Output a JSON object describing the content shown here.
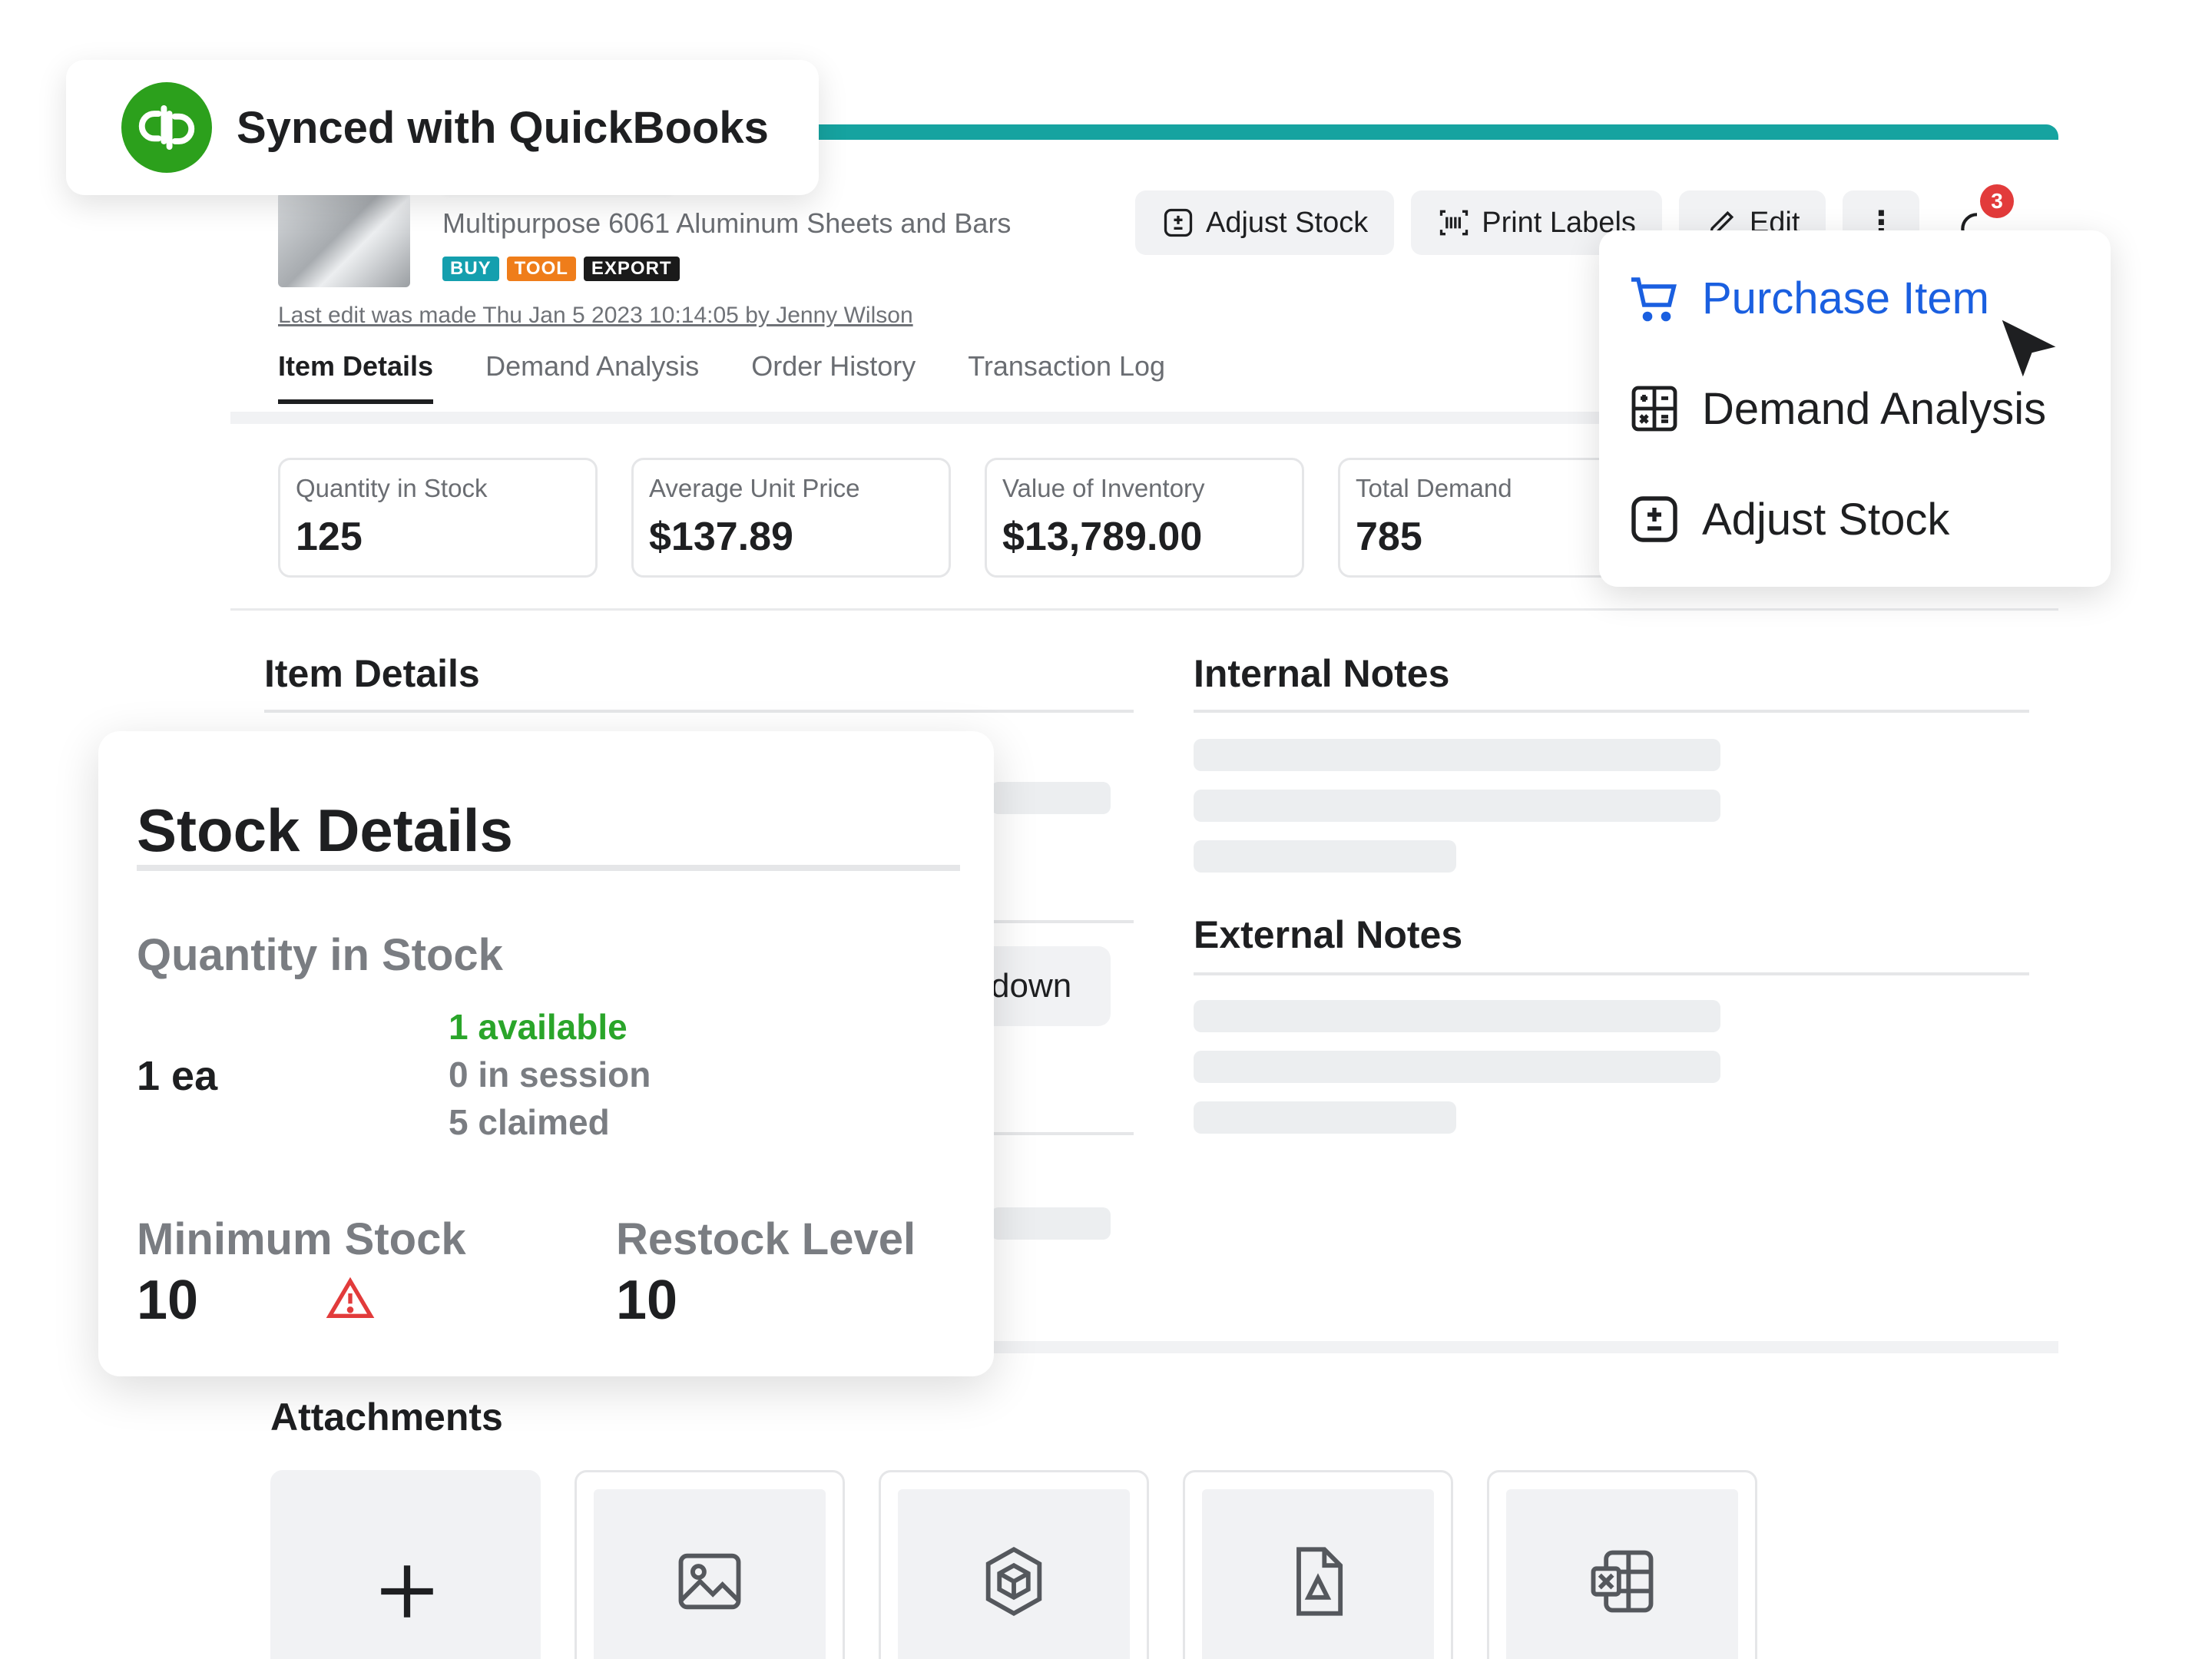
{
  "sync": {
    "label": "Synced with QuickBooks"
  },
  "product": {
    "name": "Multipurpose 6061 Aluminum Sheets and Bars",
    "tags": [
      "BUY",
      "TOOL",
      "EXPORT"
    ],
    "last_edit": "Last edit was made Thu Jan 5 2023 10:14:05 by Jenny Wilson"
  },
  "toolbar": {
    "adjust_stock": "Adjust Stock",
    "print_labels": "Print Labels",
    "edit": "Edit",
    "more": "⋮",
    "notifications_count": "3"
  },
  "tabs": [
    "Item Details",
    "Demand Analysis",
    "Order History",
    "Transaction Log"
  ],
  "stats": [
    {
      "label": "Quantity in Stock",
      "value": "125"
    },
    {
      "label": "Average Unit Price",
      "value": "$137.89"
    },
    {
      "label": "Value of Inventory",
      "value": "$13,789.00"
    },
    {
      "label": "Total Demand",
      "value": "785"
    }
  ],
  "sections": {
    "item_details": "Item Details",
    "internal_notes": "Internal Notes",
    "external_notes": "External Notes",
    "attachments": "Attachments",
    "breakdown_fragment": "down"
  },
  "dropdown": {
    "items": [
      "Purchase Item",
      "Demand Analysis",
      "Adjust Stock"
    ]
  },
  "stock_card": {
    "title": "Stock Details",
    "qty_label": "Quantity in Stock",
    "qty_value": "1 ea",
    "available": "1 available",
    "in_session": "0 in session",
    "claimed": "5 claimed",
    "min_label": "Minimum Stock",
    "min_value": "10",
    "restock_label": "Restock Level",
    "restock_value": "10"
  },
  "colors": {
    "accent_teal": "#16a3a0",
    "primary_blue": "#1a5fe0",
    "available_green": "#2aa52a",
    "warning_red": "#e23b3b",
    "quickbooks_green": "#2ca01c"
  }
}
